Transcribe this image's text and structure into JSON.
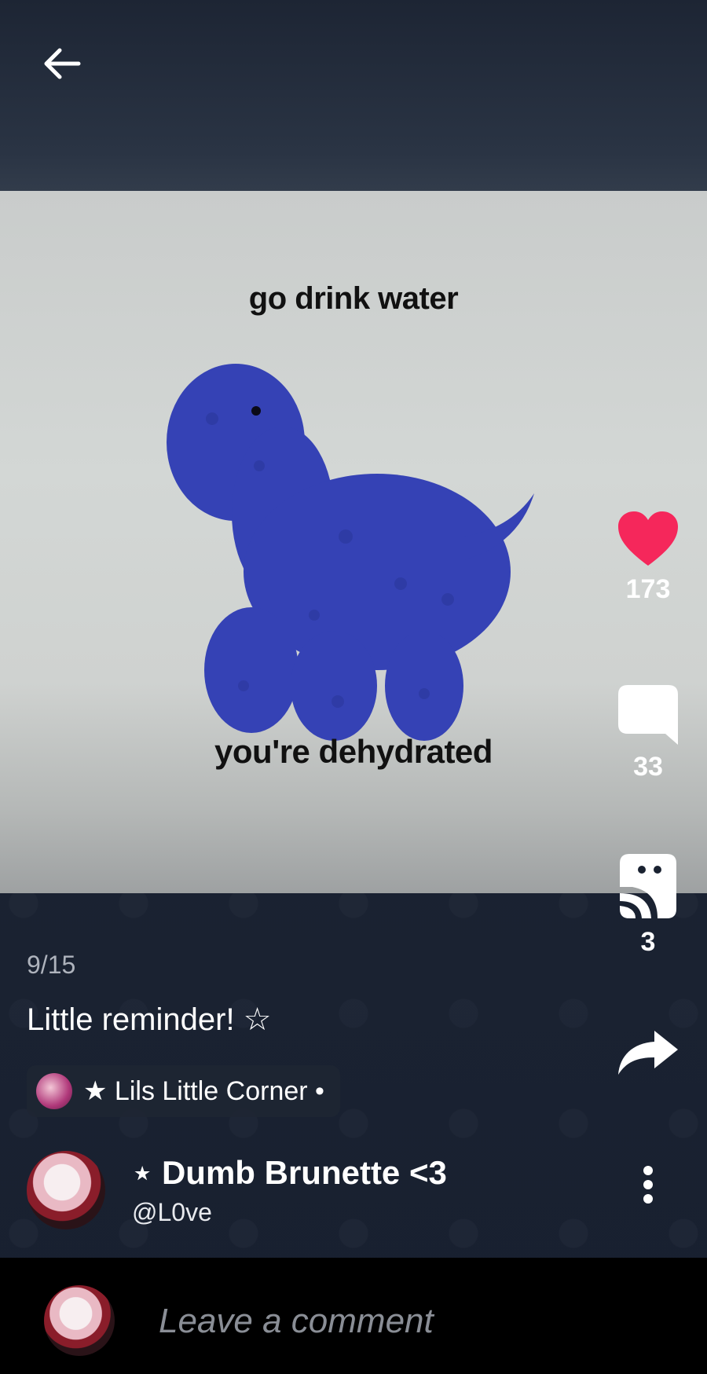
{
  "header": {
    "back_icon": "arrow-left-icon"
  },
  "post": {
    "image_text_top": "go drink water",
    "image_text_bottom": "you're dehydrated",
    "page_indicator": "9/15",
    "caption": "Little reminder! ☆",
    "community": {
      "label": "★ Lils Little Corner •"
    },
    "author": {
      "name": "⋆ Dumb Brunette <3",
      "handle": "@L0ve"
    }
  },
  "actions": {
    "like": {
      "icon": "heart-icon",
      "count": "173",
      "color": "#f5275b"
    },
    "comment": {
      "icon": "comment-bubble-icon",
      "count": "33"
    },
    "props": {
      "icon": "props-icon",
      "count": "3"
    },
    "share": {
      "icon": "share-arrow-icon"
    },
    "more": {
      "icon": "more-vertical-icon"
    }
  },
  "comment_bar": {
    "placeholder": "Leave a comment"
  }
}
